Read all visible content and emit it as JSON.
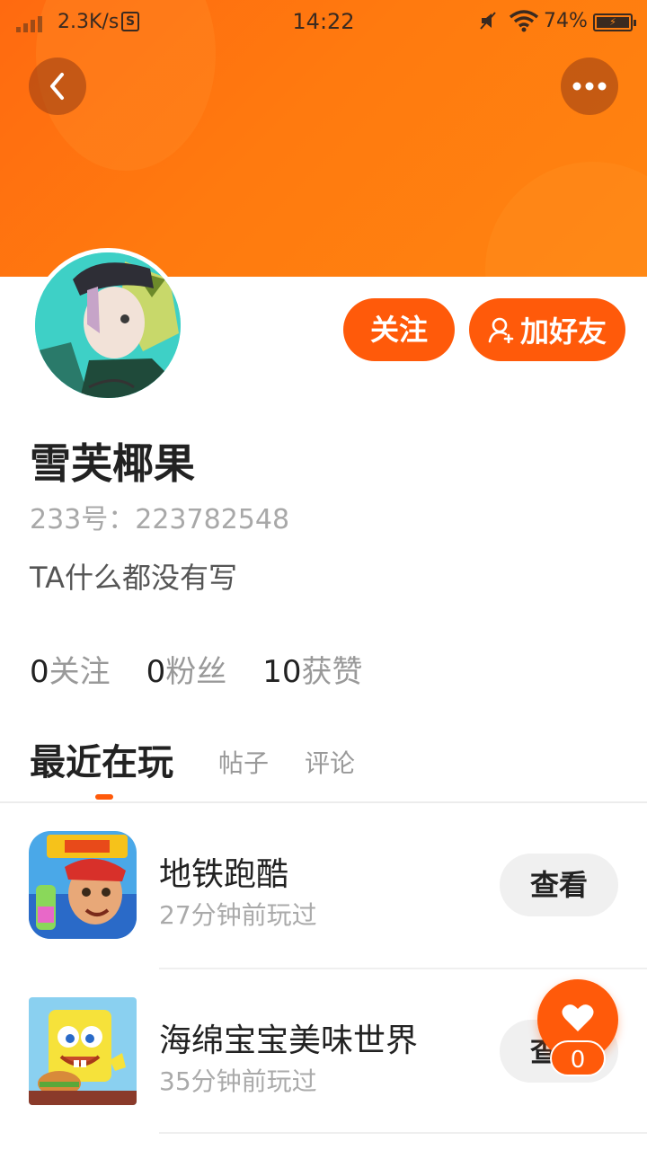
{
  "status_bar": {
    "net_speed": "2.3K/s",
    "s_badge": "S",
    "time": "14:22",
    "battery_pct": "74%",
    "icons": [
      "signal-icon",
      "mute-icon",
      "wifi-icon",
      "battery-charging-icon"
    ]
  },
  "header": {
    "back_icon": "chevron-left-icon",
    "more_icon": "more-dots-icon",
    "colors": {
      "banner_start": "#ff6a10",
      "banner_end": "#ff8410",
      "accent": "#ff5a0a"
    }
  },
  "profile": {
    "follow_label": "关注",
    "add_friend_label": "加好友",
    "add_friend_icon": "add-user-icon",
    "name": "雪芙椰果",
    "id_text": "233号：223782548",
    "bio": "TA什么都没有写"
  },
  "stats": [
    {
      "num": "0",
      "label": "关注"
    },
    {
      "num": "0",
      "label": "粉丝"
    },
    {
      "num": "10",
      "label": "获赞"
    }
  ],
  "tabs": [
    {
      "label": "最近在玩",
      "active": true
    },
    {
      "label": "帖子",
      "active": false
    },
    {
      "label": "评论",
      "active": false
    }
  ],
  "games": [
    {
      "name": "地铁跑酷",
      "time": "27分钟前玩过",
      "button": "查看",
      "icon": "subway-surfers-icon"
    },
    {
      "name": "海绵宝宝美味世界",
      "time": "35分钟前玩过",
      "button": "查看",
      "icon": "spongebob-icon"
    }
  ],
  "like": {
    "icon": "heart-icon",
    "count": "0"
  }
}
